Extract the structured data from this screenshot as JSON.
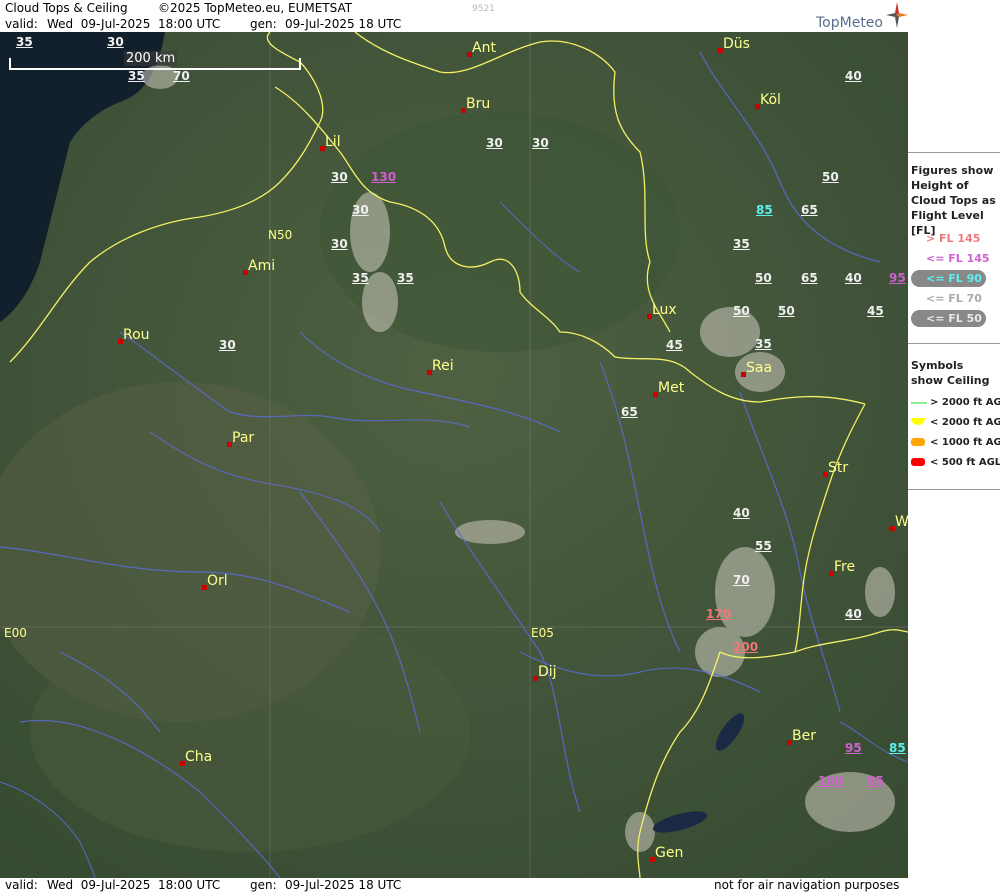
{
  "header": {
    "title": "Cloud Tops & Ceiling",
    "copyright": "©2025 TopMeteo.eu, EUMETSAT",
    "valid_label": "valid:",
    "valid_value": "Wed  09-Jul-2025  18:00 UTC",
    "gen_label": "gen:",
    "gen_value": "09-Jul-2025 18 UTC",
    "code": "9521",
    "brand": "TopMeteo"
  },
  "footer": {
    "valid_label": "valid:",
    "valid_value": "Wed  09-Jul-2025  18:00 UTC",
    "gen_label": "gen:",
    "gen_value": "09-Jul-2025 18 UTC",
    "disclaimer": "not for air navigation purposes"
  },
  "scale": {
    "label": "200 km"
  },
  "graticule": {
    "lon0": "E00",
    "lon5": "E05",
    "lat50": "N50"
  },
  "cities": [
    "Ant",
    "Düs",
    "Bru",
    "Köl",
    "Lil",
    "Ami",
    "Rou",
    "Rei",
    "Lux",
    "Met",
    "Saa",
    "Par",
    "Str",
    "W",
    "Fre",
    "Orl",
    "Dij",
    "Ber",
    "Cha",
    "Gen"
  ],
  "levels": [
    "35",
    "30",
    "35",
    "70",
    "40",
    "30",
    "30",
    "30",
    "130",
    "50",
    "30",
    "85",
    "65",
    "30",
    "35",
    "35",
    "35",
    "50",
    "65",
    "40",
    "95",
    "50",
    "50",
    "45",
    "35",
    "30",
    "45",
    "65",
    "40",
    "55",
    "70",
    "170",
    "40",
    "200",
    "95",
    "85",
    "100",
    "95"
  ],
  "legend": {
    "figures_title": "Figures show Height of Cloud Tops as Flight Level  [FL]",
    "fl_items": [
      {
        "label": "> FL 145",
        "color": "#f07878"
      },
      {
        "label": "<= FL 145",
        "color": "#d060d0"
      },
      {
        "label": "<= FL 90",
        "color": "#5cf0f0"
      },
      {
        "label": "<= FL 70",
        "color": "#c8c8c8"
      },
      {
        "label": "<= FL 50",
        "color": "#e8e8e8"
      }
    ],
    "symbols_title": "Symbols show Ceiling",
    "ceiling_items": [
      {
        "label": "> 2000 ft AGL",
        "color": "#90ee90"
      },
      {
        "label": "< 2000 ft AGL",
        "color": "#ffff00"
      },
      {
        "label": "< 1000 ft AGL",
        "color": "#ffa500"
      },
      {
        "label": "< 500 ft AGL",
        "color": "#ff0000"
      }
    ]
  }
}
